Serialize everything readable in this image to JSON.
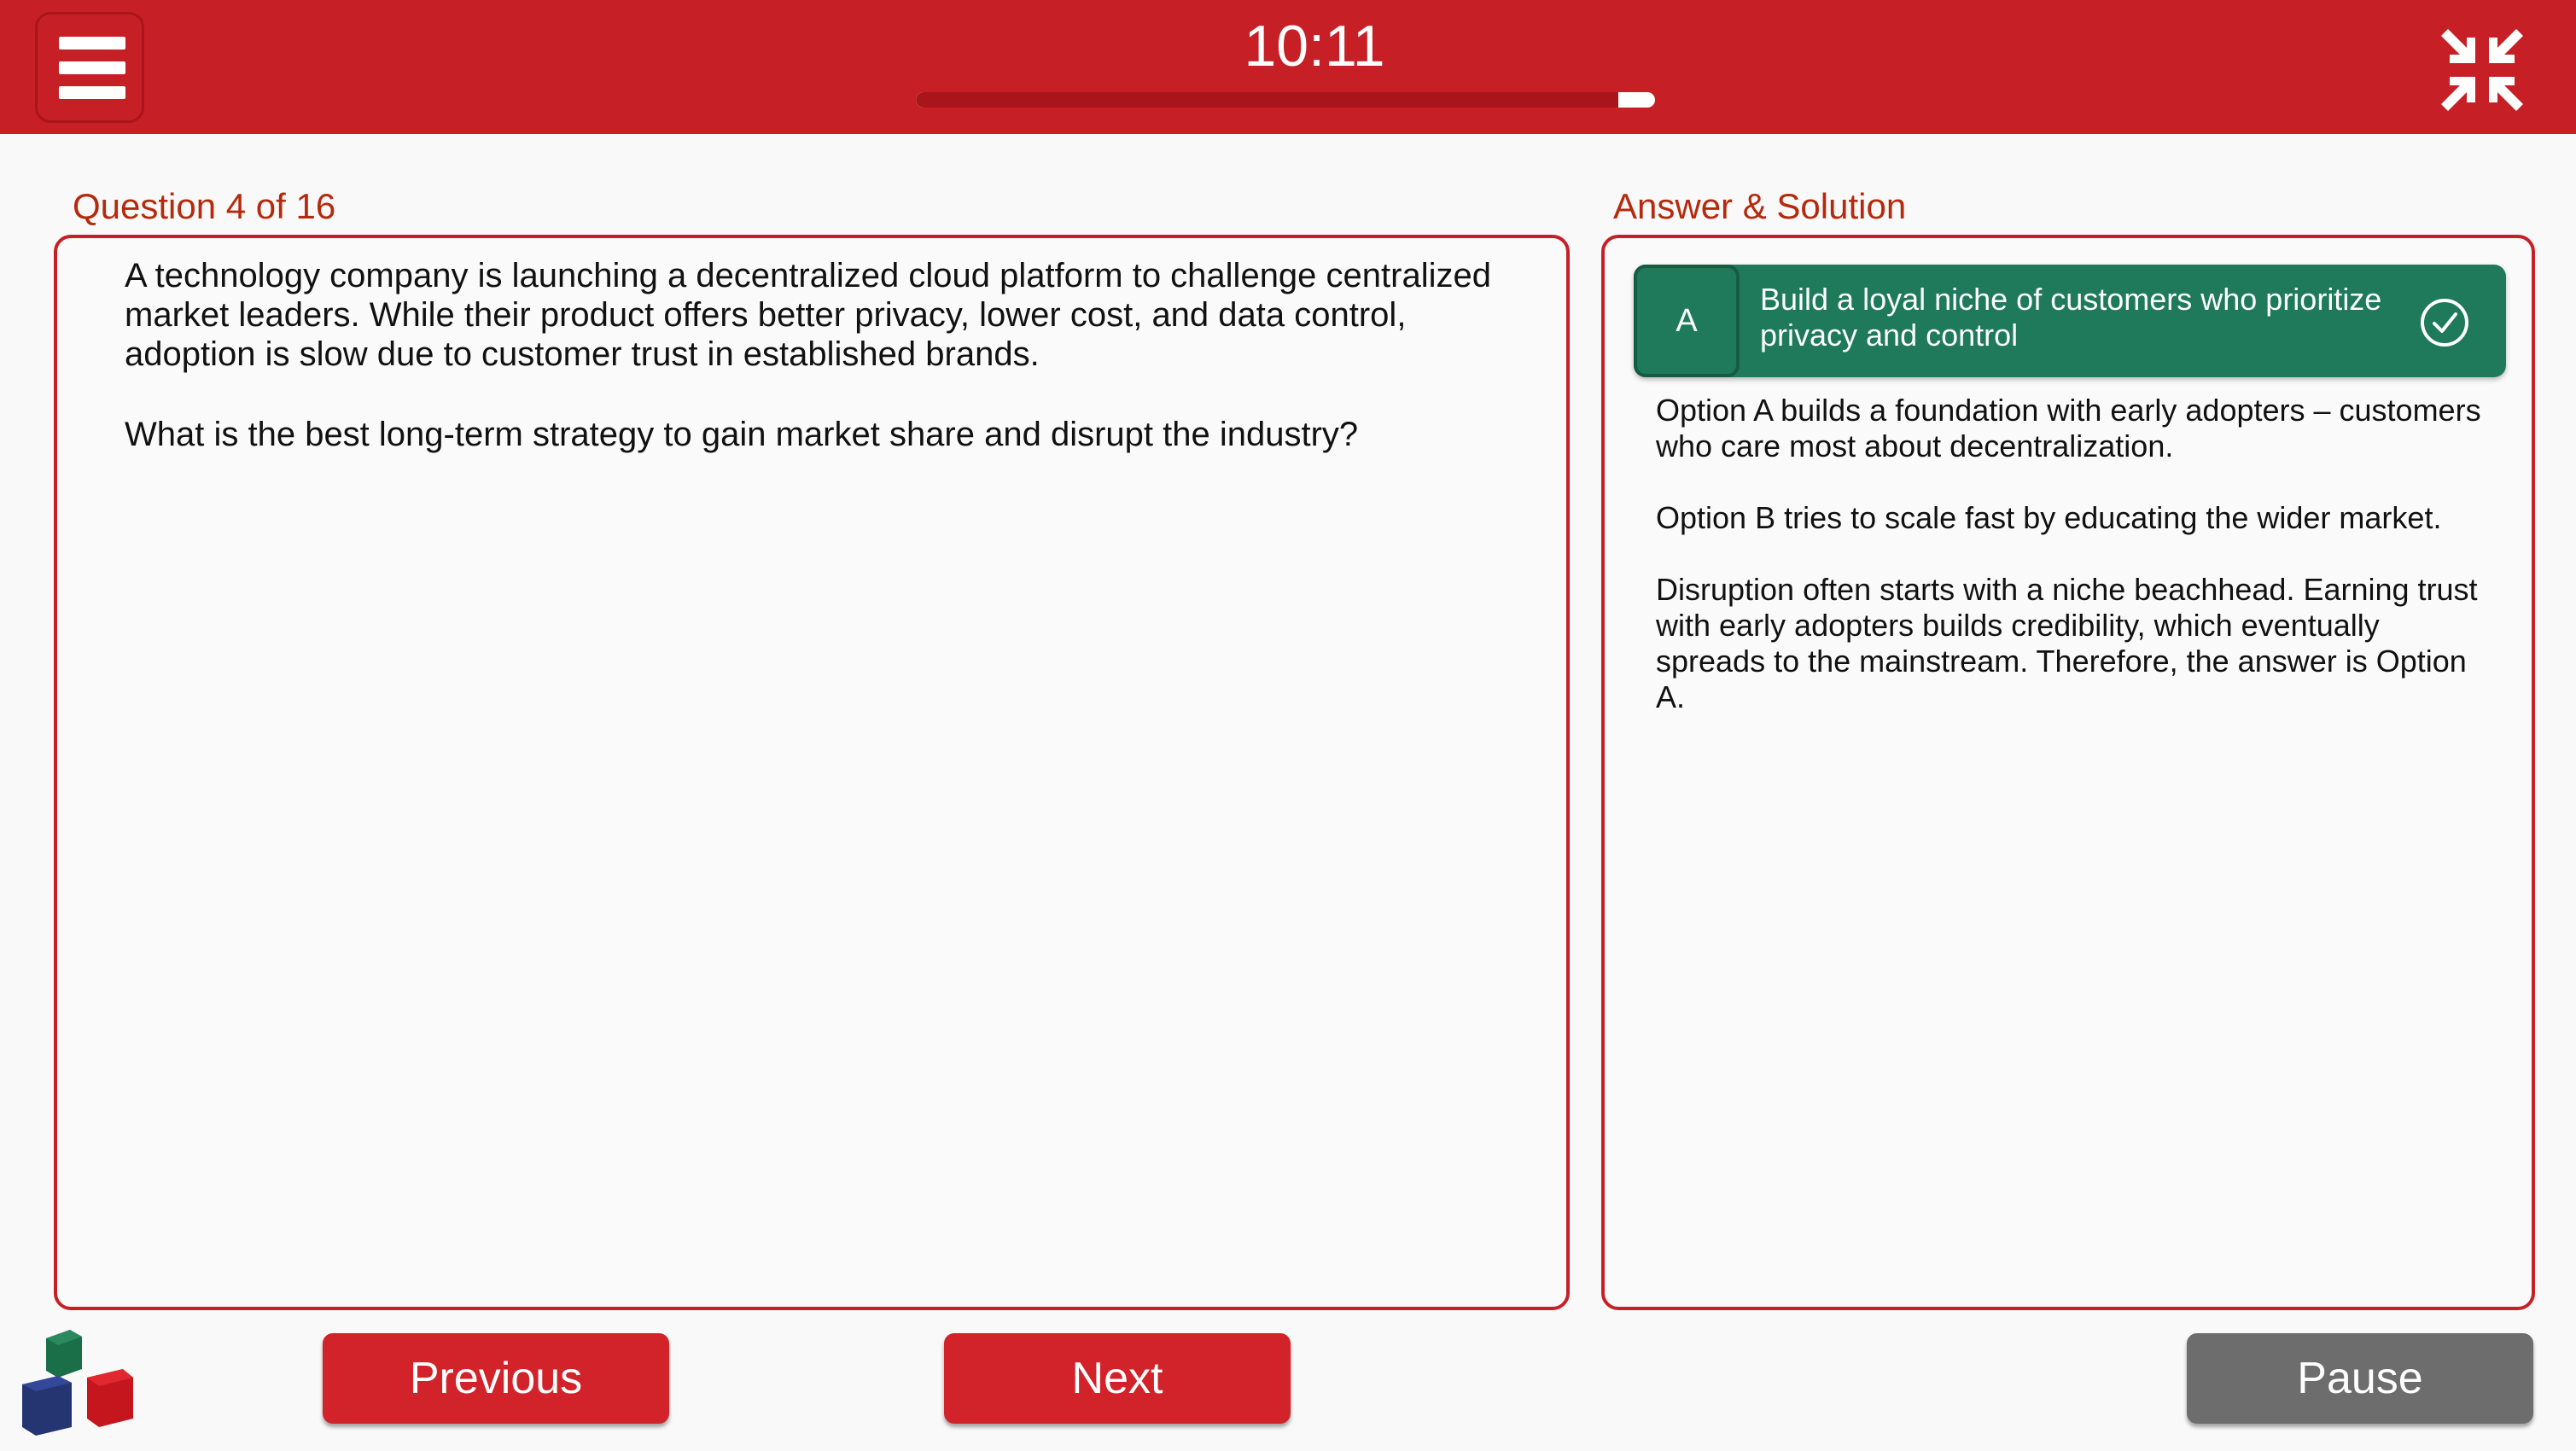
{
  "header": {
    "timer": "10:11",
    "progress": 0.95
  },
  "question": {
    "label": "Question 4 of 16",
    "paragraphs": [
      "A technology company is launching a decentralized cloud platform to challenge centralized market leaders. While their product offers better privacy, lower cost, and data control, adoption is slow due to customer trust in established brands.",
      "What is the best long-term strategy to gain market share and disrupt the industry?"
    ]
  },
  "answer": {
    "label": "Answer & Solution",
    "letter": "A",
    "text": "Build a loyal niche of customers who prioritize privacy and control",
    "solution": [
      "Option A builds a foundation with early adopters – customers who care most about decentralization.",
      "Option B tries to scale fast by educating the wider market.",
      "Disruption often starts with a niche beachhead. Earning trust with early adopters builds credibility, which eventually spreads to the mainstream. Therefore, the answer is Option A."
    ]
  },
  "footer": {
    "previous_label": "Previous",
    "next_label": "Next",
    "pause_label": "Pause"
  },
  "icons": {
    "menu": "hamburger-menu-icon",
    "collapse": "collapse-fullscreen-icon",
    "check": "check-circle-icon",
    "logo": "cubes-logo"
  },
  "colors": {
    "brand_red": "#c62026",
    "correct_green": "#1e7a5a",
    "label_orange": "#b52a0d",
    "pause_gray": "#6d6d6d"
  }
}
